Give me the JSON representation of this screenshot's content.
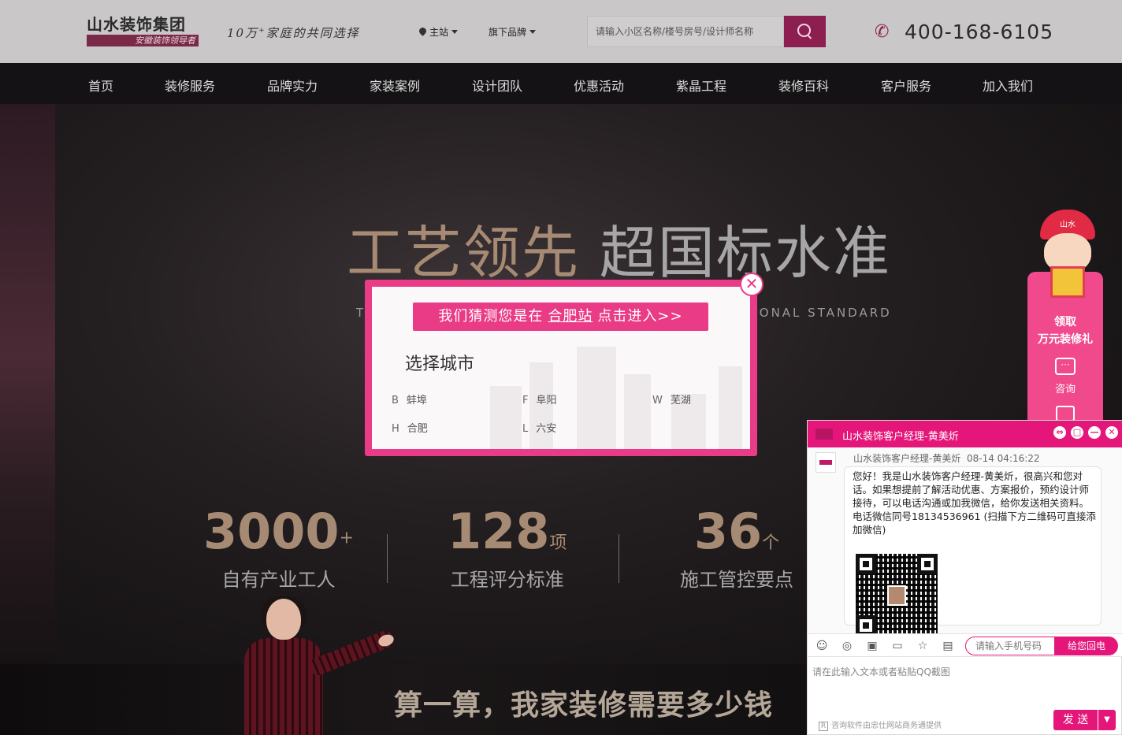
{
  "header": {
    "logo_main": "山水装饰集团",
    "logo_sub": "安徽装饰领导者",
    "slogan_prefix": "10万",
    "slogan_sup": "+",
    "slogan_suffix": "家庭的共同选择",
    "location_label": "主站",
    "brands_label": "旗下品牌",
    "search_placeholder": "请输入小区名称/楼号房号/设计师名称",
    "hotline": "400-168-6105"
  },
  "nav": {
    "items": [
      "首页",
      "装修服务",
      "品牌实力",
      "家装案例",
      "设计团队",
      "优惠活动",
      "紫晶工程",
      "装修百科",
      "客户服务",
      "加入我们"
    ]
  },
  "hero": {
    "title_gold": "工艺领先",
    "title_grey": "超国标水准",
    "subtitle_left": "T",
    "subtitle_right": "TIONAL STANDARD",
    "stats": [
      {
        "num": "3000",
        "sup": "+",
        "unit": "",
        "label": "自有产业工人"
      },
      {
        "num": "128",
        "sup": "",
        "unit": "项",
        "label": "工程评分标准"
      },
      {
        "num": "36",
        "sup": "",
        "unit": "个",
        "label": "施工管控要点"
      }
    ]
  },
  "banner": {
    "text": "算一算，我家装修需要多少钱"
  },
  "city_modal": {
    "guess_prefix": "我们猜测您是在",
    "guess_city": "合肥站",
    "guess_suffix": "点击进入>>",
    "choose_title": "选择城市",
    "cities": [
      {
        "letter": "B",
        "name": "蚌埠"
      },
      {
        "letter": "F",
        "name": "阜阳"
      },
      {
        "letter": "W",
        "name": "芜湖"
      },
      {
        "letter": "H",
        "name": "合肥"
      },
      {
        "letter": "L",
        "name": "六安"
      }
    ],
    "close_glyph": "✕"
  },
  "float": {
    "mascot_cap_text": "山水",
    "title_line1": "领取",
    "title_line2": "万元装修礼",
    "consult_label": "咨询",
    "consult_icon": "···"
  },
  "chat": {
    "title": "山水装饰客户经理-黄美炘",
    "controls": [
      "⇔",
      "□",
      "—",
      "✕"
    ],
    "sender": "山水装饰客户经理-黄美炘",
    "time": "08-14 04:16:22",
    "message": "您好！我是山水装饰客户经理-黄美炘，很高兴和您对话。如果想提前了解活动优惠、方案报价，预约设计师接待，可以电话沟通或加我微信，给你发送相关资料。电话微信同号18134536961 (扫描下方二维码可直接添加微信)",
    "phone_placeholder": "请输入手机号码",
    "callback_label": "给您回电",
    "input_placeholder": "请在此输入文本或者粘贴QQ截图",
    "powered_text": "咨询软件由忠仕网站商务通提供",
    "powered_badge": "R",
    "send_label": "发 送",
    "send_more": "▼"
  },
  "colors": {
    "brand_pink": "#e5167a",
    "modal_pink": "#e93b86",
    "hero_gold": "#a68a73",
    "header_bg": "#c9c7c8"
  },
  "icons": [
    "location-pin-icon",
    "chevron-down-icon",
    "search-icon",
    "phone-icon",
    "close-icon",
    "chat-bubble-icon",
    "calculator-icon",
    "emoji-icon",
    "wechat-icon",
    "image-icon",
    "folder-icon",
    "star-icon",
    "save-icon"
  ]
}
